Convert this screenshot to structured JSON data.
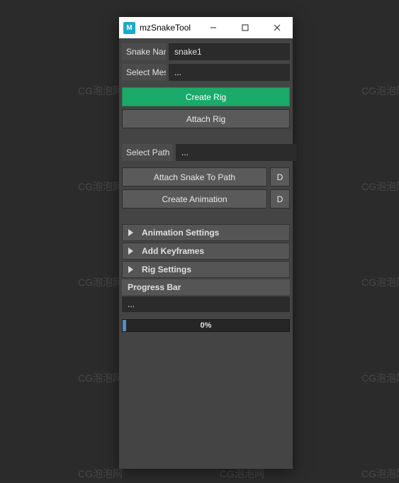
{
  "watermarks": {
    "text": "CG泡泡网"
  },
  "window": {
    "icon_letter": "M",
    "title": "mzSnakeTool"
  },
  "fields": {
    "snake_name": {
      "label": "Snake Name",
      "value": "snake1"
    },
    "select_mesh": {
      "label": "Select Mesh",
      "value": "..."
    },
    "select_path": {
      "label": "Select Path",
      "value": "..."
    }
  },
  "buttons": {
    "create_rig": "Create Rig",
    "attach_rig": "Attach Rig",
    "attach_snake_to_path": "Attach Snake To Path",
    "attach_snake_d": "D",
    "create_animation": "Create Animation",
    "create_animation_d": "D"
  },
  "collapsibles": {
    "animation_settings": "Animation Settings",
    "add_keyframes": "Add Keyframes",
    "rig_settings": "Rig Settings"
  },
  "progress": {
    "label": "Progress Bar",
    "status": "...",
    "percent_text": "0%"
  }
}
